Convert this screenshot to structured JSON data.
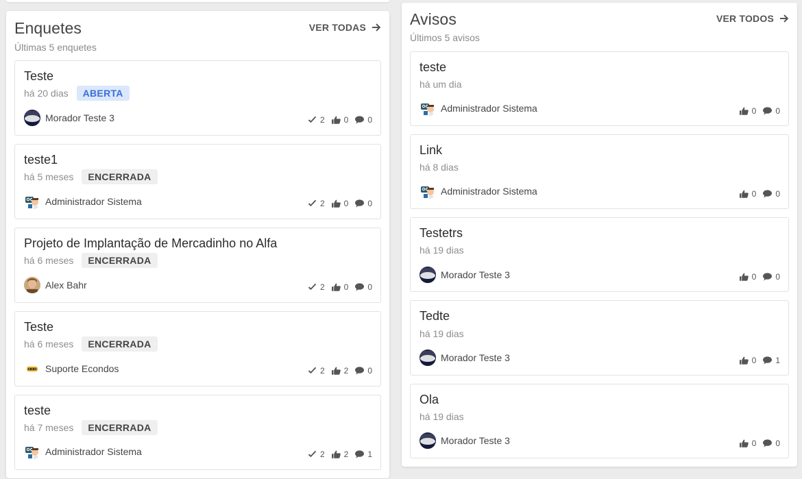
{
  "enquetes": {
    "title": "Enquetes",
    "subtitle": "Últimas 5 enquetes",
    "see_all": "VER TODAS",
    "items": [
      {
        "title": "Teste",
        "time": "há 20 dias",
        "status": "ABERTA",
        "author": "Morador Teste 3",
        "votes": "2",
        "likes": "0",
        "comments": "0"
      },
      {
        "title": "teste1",
        "time": "há 5 meses",
        "status": "ENCERRADA",
        "author": "Administrador Sistema",
        "votes": "2",
        "likes": "0",
        "comments": "0"
      },
      {
        "title": "Projeto de Implantação de Mercadinho no Alfa",
        "time": "há 6 meses",
        "status": "ENCERRADA",
        "author": "Alex Bahr",
        "votes": "2",
        "likes": "0",
        "comments": "0"
      },
      {
        "title": "Teste",
        "time": "há 6 meses",
        "status": "ENCERRADA",
        "author": "Suporte Econdos",
        "votes": "2",
        "likes": "2",
        "comments": "0"
      },
      {
        "title": "teste",
        "time": "há 7 meses",
        "status": "ENCERRADA",
        "author": "Administrador Sistema",
        "votes": "2",
        "likes": "2",
        "comments": "1"
      }
    ]
  },
  "avisos": {
    "title": "Avisos",
    "subtitle": "Últimos 5 avisos",
    "see_all": "VER TODOS",
    "items": [
      {
        "title": "teste",
        "time": "há um dia",
        "author": "Administrador Sistema",
        "likes": "0",
        "comments": "0"
      },
      {
        "title": "Link",
        "time": "há 8 dias",
        "author": "Administrador Sistema",
        "likes": "0",
        "comments": "0"
      },
      {
        "title": "Testetrs",
        "time": "há 19 dias",
        "author": "Morador Teste 3",
        "likes": "0",
        "comments": "0"
      },
      {
        "title": "Tedte",
        "time": "há 19 dias",
        "author": "Morador Teste 3",
        "likes": "0",
        "comments": "1"
      },
      {
        "title": "Ola",
        "time": "há 19 dias",
        "author": "Morador Teste 3",
        "likes": "0",
        "comments": "0"
      }
    ]
  },
  "icons": {
    "see_all": "arrow-right-icon",
    "votes": "check-icon",
    "likes": "thumbs-up-icon",
    "comments": "comment-icon"
  },
  "colors": {
    "badge_open_bg": "#dbe7fb",
    "badge_open_text": "#3a6fd8",
    "badge_closed_bg": "#efefef",
    "badge_closed_text": "#444444"
  }
}
